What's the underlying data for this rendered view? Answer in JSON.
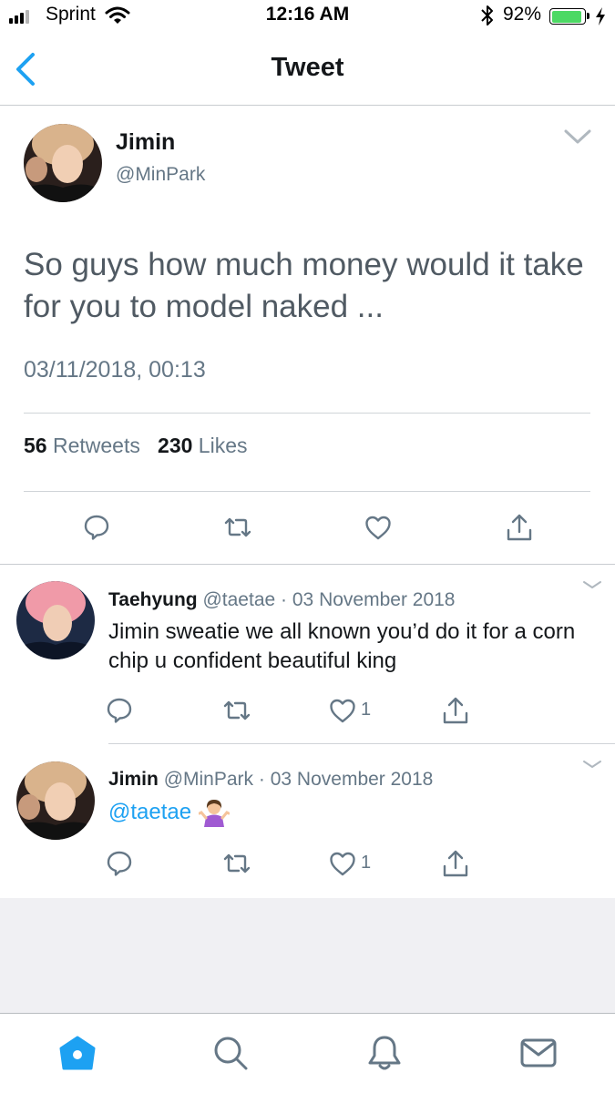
{
  "status_bar": {
    "carrier": "Sprint",
    "time": "12:16 AM",
    "battery_pct": "92%",
    "battery_level": 0.92
  },
  "nav": {
    "title": "Tweet"
  },
  "main_tweet": {
    "name": "Jimin",
    "handle": "@MinPark",
    "text": "So guys how much money would it take for you to model naked ...",
    "timestamp": "03/11/2018, 00:13",
    "retweets_count": "56",
    "retweets_label": "Retweets",
    "likes_count": "230",
    "likes_label": "Likes"
  },
  "replies": [
    {
      "name": "Taehyung",
      "handle": "@taetae",
      "separator": "·",
      "date": "03 November 2018",
      "text": "Jimin sweatie we all known you’d do it for a corn chip u confident beautiful king",
      "like_count": "1"
    },
    {
      "name": "Jimin",
      "handle": "@MinPark",
      "separator": "·",
      "date": "03 November 2018",
      "mention": "@taetae",
      "like_count": "1"
    }
  ],
  "colors": {
    "accent": "#1da1f2",
    "text_primary": "#14171a",
    "text_secondary": "#657786",
    "icon": "#657786",
    "battery": "#4cd964",
    "home_active": "#1da1f2"
  },
  "icons": {
    "back": "chevron-left-icon",
    "caret": "chevron-down-icon",
    "reply": "reply-icon",
    "retweet": "retweet-icon",
    "like": "heart-icon",
    "share": "share-icon",
    "tabs": [
      "home-icon",
      "search-icon",
      "bell-icon",
      "mail-icon"
    ]
  }
}
